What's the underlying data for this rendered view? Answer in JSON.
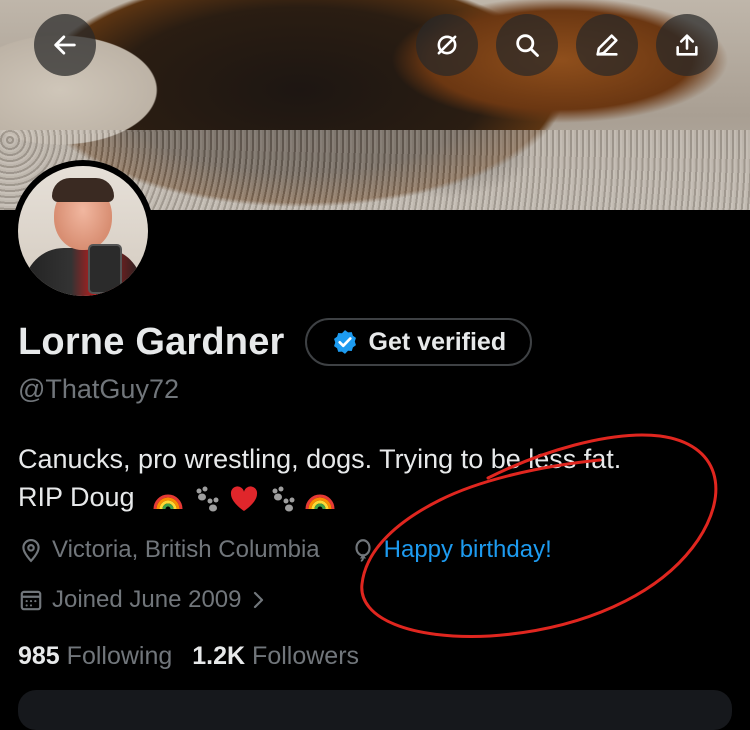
{
  "profile": {
    "name": "Lorne Gardner",
    "verify_label": "Get verified",
    "handle": "@ThatGuy72",
    "bio_line1": "Canucks, pro wrestling, dogs. Trying to be less fat.",
    "bio_line2": "RIP Doug",
    "bio_emojis": [
      "rainbow",
      "paw-prints",
      "red-heart",
      "paw-prints",
      "rainbow"
    ],
    "location": "Victoria, British Columbia",
    "birthday": "Happy birthday!",
    "joined": "Joined June 2009",
    "following_count": "985",
    "following_label": "Following",
    "followers_count": "1.2K",
    "followers_label": "Followers"
  },
  "colors": {
    "background": "#000000",
    "text": "#e7e9ea",
    "muted": "#71767b",
    "link": "#1d9bf0",
    "verified_badge": "#1d9bf0",
    "annotation": "#e0261f"
  },
  "icons": {
    "back": "back-arrow-icon",
    "mute_notifications": "no-notification-icon",
    "search": "search-icon",
    "edit": "pencil-icon",
    "share": "share-icon",
    "location": "location-pin-icon",
    "birthday": "balloon-icon",
    "calendar": "calendar-icon"
  }
}
